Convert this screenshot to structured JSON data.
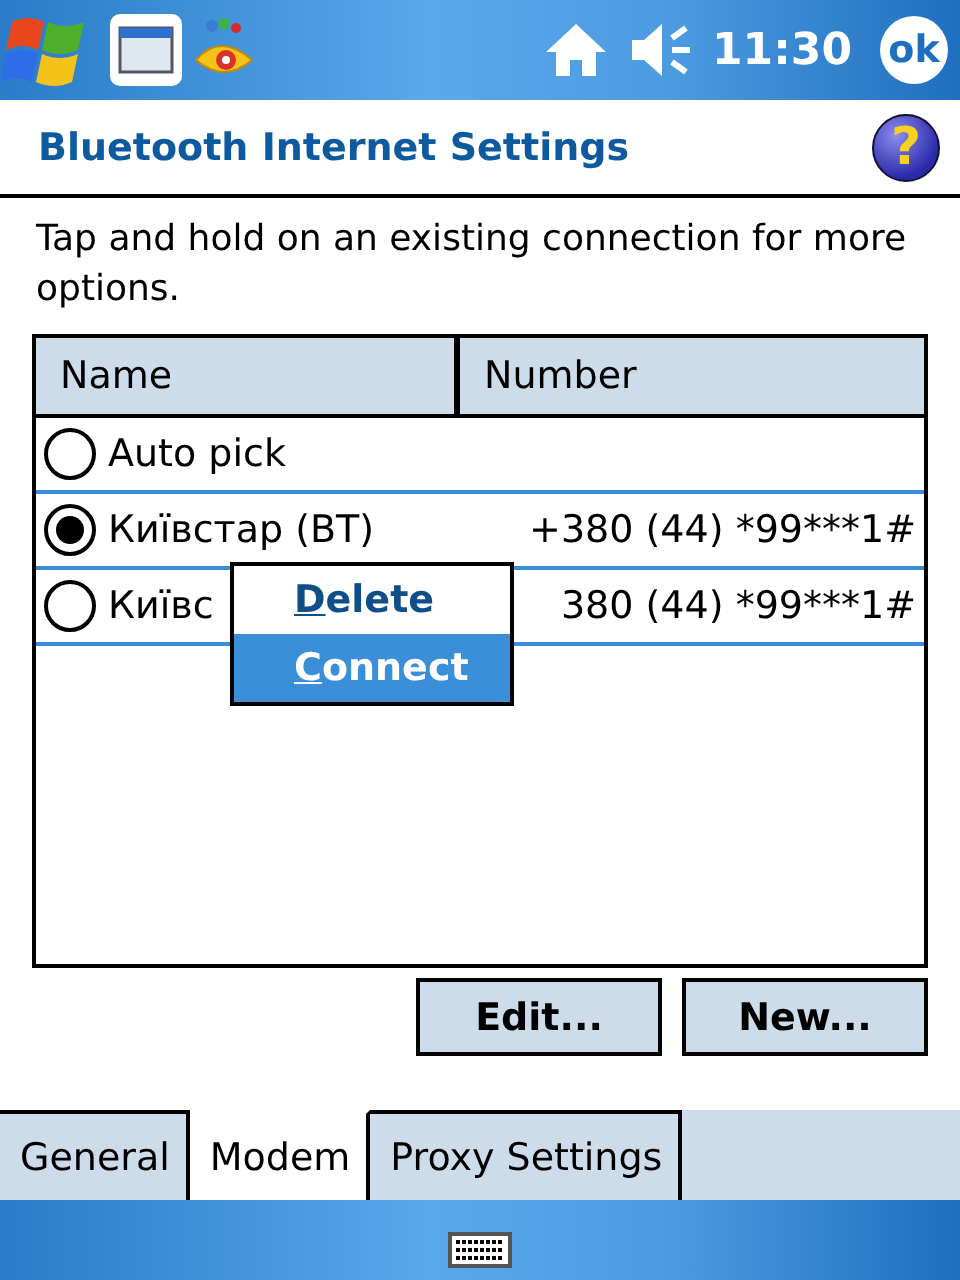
{
  "status_bar": {
    "time": "11:30",
    "ok_button": "ok"
  },
  "header": {
    "title": "Bluetooth Internet Settings",
    "help": "?"
  },
  "instructions": "Tap and hold on an existing connection for more options.",
  "table": {
    "columns": [
      "Name",
      "Number"
    ],
    "rows": [
      {
        "name": "Auto pick",
        "selected": false
      },
      {
        "name": "Київстар (BT)",
        "number": "+380 (44) *99***1#",
        "selected": true
      },
      {
        "name": "Київс",
        "number": "380 (44) *99***1#",
        "selected": false
      }
    ]
  },
  "context_menu": [
    {
      "label": "Delete",
      "highlighted": false
    },
    {
      "label": "Connect",
      "highlighted": true
    }
  ],
  "buttons": [
    "Edit...",
    "New..."
  ],
  "tabs": [
    {
      "label": "General",
      "selected": false
    },
    {
      "label": "Modem",
      "selected": true
    },
    {
      "label": "Proxy Settings",
      "selected": false
    }
  ]
}
